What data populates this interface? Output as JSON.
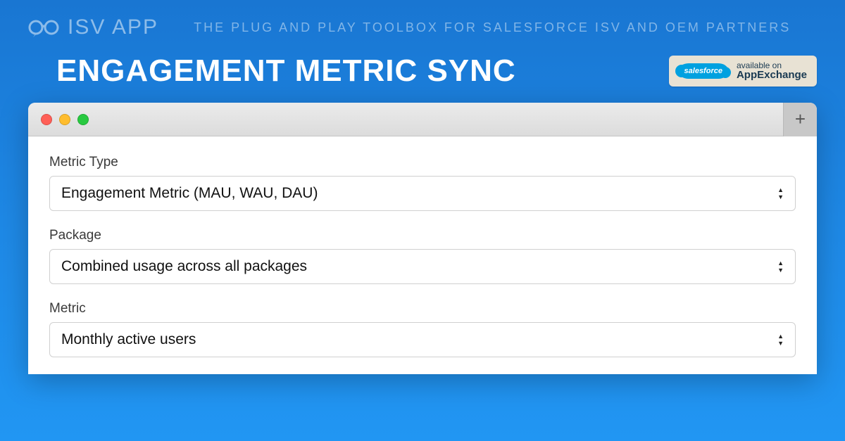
{
  "header": {
    "brand": "ISV aPP",
    "tagline": "THE PLUG AND PLAY TOOLBOX FOR SALESFORCE ISV AND OEM PARTNERS"
  },
  "title": "ENGAGEMENT METRIC SYNC",
  "badge": {
    "cloud": "salesforce",
    "line1": "available on",
    "line2": "AppExchange"
  },
  "form": {
    "metric_type": {
      "label": "Metric Type",
      "value": "Engagement Metric (MAU, WAU, DAU)"
    },
    "package": {
      "label": "Package",
      "value": "Combined usage across all packages"
    },
    "metric": {
      "label": "Metric",
      "value": "Monthly active users"
    }
  }
}
